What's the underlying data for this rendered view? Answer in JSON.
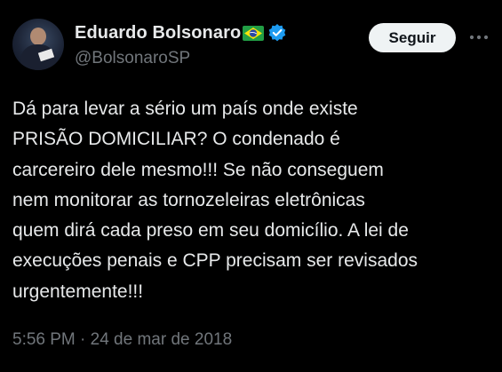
{
  "author": {
    "display_name": "Eduardo Bolsonaro",
    "handle": "@BolsonaroSP",
    "flag_icon": "brazil-flag-icon",
    "verified_icon": "verified-badge-icon"
  },
  "actions": {
    "follow_label": "Seguir",
    "more_icon": "more-options-icon"
  },
  "tweet": {
    "text": "Dá para levar a sério um país onde existe\nPRISÃO DOMICILIAR? O condenado é\ncarcereiro dele mesmo!!! Se não conseguem\nnem monitorar as tornozeleiras eletrônicas\nquem dirá cada preso em seu domicílio. A lei de\nexecuções penais e CPP precisam ser revisados\nurgentemente!!!",
    "timestamp": "5:56 PM · 24 de mar de 2018"
  },
  "colors": {
    "background": "#000000",
    "text": "#e7e9ea",
    "secondary_text": "#71767b",
    "verified_blue": "#1d9bf0",
    "button_bg": "#eff3f4"
  }
}
